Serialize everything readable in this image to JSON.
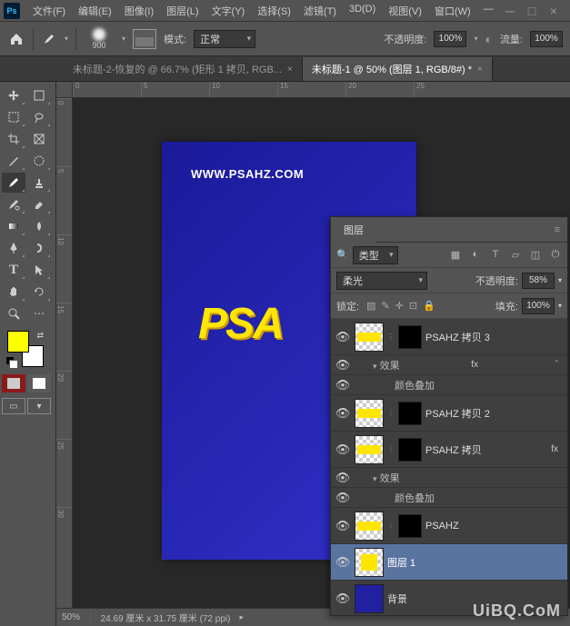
{
  "app": {
    "logo": "Ps"
  },
  "menu": {
    "file": "文件(F)",
    "edit": "编辑(E)",
    "image": "图像(I)",
    "layer": "图层(L)",
    "type": "文字(Y)",
    "select": "选择(S)",
    "filter": "滤镜(T)",
    "threeD": "3D(D)",
    "view": "视图(V)",
    "window": "窗口(W)",
    "dash": "—"
  },
  "options": {
    "brush_size": "900",
    "mode_label": "模式:",
    "mode_value": "正常",
    "opacity_label": "不透明度:",
    "opacity_value": "100%",
    "flow_label": "流量:",
    "flow_value": "100%"
  },
  "tabs": {
    "left": "未标题-2-恢复的 @ 66.7% (矩形 1 拷贝, RGB...",
    "right": "未标题-1 @ 50% (图层 1, RGB/8#) *"
  },
  "ruler_h": [
    "0",
    "5",
    "10",
    "15",
    "20",
    "25"
  ],
  "ruler_v": [
    "0",
    "5",
    "10",
    "15",
    "20",
    "25",
    "30"
  ],
  "canvas": {
    "url_text": "WWW.PSAHZ.COM",
    "big_text": "PSA"
  },
  "status": {
    "zoom": "50%",
    "dims": "24.69 厘米 x 31.75 厘米 (72 ppi)"
  },
  "panel": {
    "tab_layers": "图层",
    "filter_label": "类型",
    "blend_mode": "柔光",
    "opacity_label": "不透明度:",
    "opacity_value": "58%",
    "lock_label": "锁定:",
    "fill_label": "填充:",
    "fill_value": "100%"
  },
  "layers": [
    {
      "name": "PSAHZ 拷贝 3",
      "has_fx": true
    },
    {
      "name": "PSAHZ 拷贝 2",
      "has_fx": false
    },
    {
      "name": "PSAHZ 拷贝",
      "has_fx": true
    },
    {
      "name": "PSAHZ",
      "has_fx": false
    },
    {
      "name": "图层 1",
      "selected": true
    },
    {
      "name": "背景",
      "bg": true
    }
  ],
  "fx": {
    "effects_label": "效果",
    "color_overlay": "颜色叠加",
    "badge": "fx"
  },
  "watermark": "UiBQ.CoM"
}
